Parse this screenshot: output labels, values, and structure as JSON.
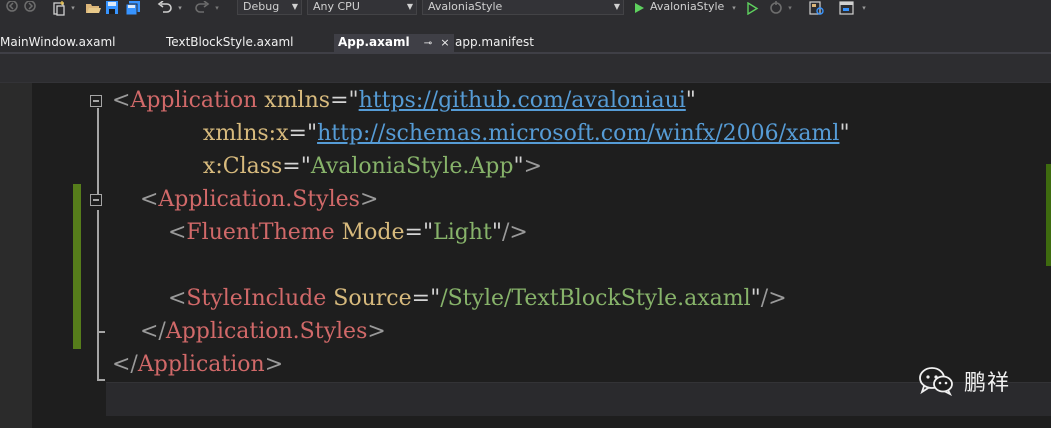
{
  "toolbar": {
    "configuration": "Debug",
    "platform": "Any CPU",
    "startup_project": "AvaloniaStyle",
    "start_target": "AvaloniaStyle",
    "icons": [
      "back-icon",
      "forward-icon",
      "new-project-icon",
      "open-file-icon",
      "save-icon",
      "save-all-icon",
      "undo-icon",
      "redo-icon",
      "start-icon",
      "start-without-debugging-icon",
      "hot-reload-icon",
      "find-in-files-icon",
      "layout-icon"
    ]
  },
  "tabs": [
    {
      "label": "MainWindow.axaml",
      "active": false
    },
    {
      "label": "TextBlockStyle.axaml",
      "active": false
    },
    {
      "label": "App.axaml",
      "active": true
    },
    {
      "label": "app.manifest",
      "active": false
    }
  ],
  "tab_pin_glyph": "⊸",
  "tab_close_glyph": "×",
  "code": {
    "lines": [
      [
        {
          "t": "<",
          "c": "punct"
        },
        {
          "t": "Application",
          "c": "tag"
        },
        {
          "t": " xmlns",
          "c": "attr"
        },
        {
          "t": "=",
          "c": "eq"
        },
        {
          "t": "\"",
          "c": "quote"
        },
        {
          "t": "https://github.com/avaloniaui",
          "c": "url"
        },
        {
          "t": "\"",
          "c": "quote"
        }
      ],
      [
        {
          "t": "             xmlns:x",
          "c": "attr"
        },
        {
          "t": "=",
          "c": "eq"
        },
        {
          "t": "\"",
          "c": "quote"
        },
        {
          "t": "http://schemas.microsoft.com/winfx/2006/xaml",
          "c": "url"
        },
        {
          "t": "\"",
          "c": "quote"
        }
      ],
      [
        {
          "t": "             x:Class",
          "c": "attr"
        },
        {
          "t": "=",
          "c": "eq"
        },
        {
          "t": "\"",
          "c": "quote"
        },
        {
          "t": "AvaloniaStyle.App",
          "c": "val"
        },
        {
          "t": "\"",
          "c": "quote"
        },
        {
          "t": ">",
          "c": "punct"
        }
      ],
      [
        {
          "t": "    <",
          "c": "punct"
        },
        {
          "t": "Application.Styles",
          "c": "tag"
        },
        {
          "t": ">",
          "c": "punct"
        }
      ],
      [
        {
          "t": "        <",
          "c": "punct"
        },
        {
          "t": "FluentTheme",
          "c": "tag"
        },
        {
          "t": " Mode",
          "c": "attr"
        },
        {
          "t": "=",
          "c": "eq"
        },
        {
          "t": "\"",
          "c": "quote"
        },
        {
          "t": "Light",
          "c": "val"
        },
        {
          "t": "\"",
          "c": "quote"
        },
        {
          "t": "/>",
          "c": "punct"
        }
      ],
      [],
      [
        {
          "t": "        <",
          "c": "punct"
        },
        {
          "t": "StyleInclude",
          "c": "tag"
        },
        {
          "t": " Source",
          "c": "attr"
        },
        {
          "t": "=",
          "c": "eq"
        },
        {
          "t": "\"",
          "c": "quote"
        },
        {
          "t": "/Style/TextBlockStyle.axaml",
          "c": "val"
        },
        {
          "t": "\"",
          "c": "quote"
        },
        {
          "t": "/>",
          "c": "punct"
        }
      ],
      [
        {
          "t": "    </",
          "c": "punct"
        },
        {
          "t": "Application.Styles",
          "c": "tag"
        },
        {
          "t": ">",
          "c": "punct"
        }
      ],
      [
        {
          "t": "</",
          "c": "punct"
        },
        {
          "t": "Application",
          "c": "tag"
        },
        {
          "t": ">",
          "c": "punct"
        }
      ]
    ]
  },
  "watermark": {
    "text": "鹏祥",
    "icon": "wechat-icon"
  },
  "colors": {
    "tag": "#d16969",
    "attribute": "#d7ba7d",
    "value": "#87b36a",
    "url": "#569cd6",
    "change_marker": "#567d1b"
  }
}
